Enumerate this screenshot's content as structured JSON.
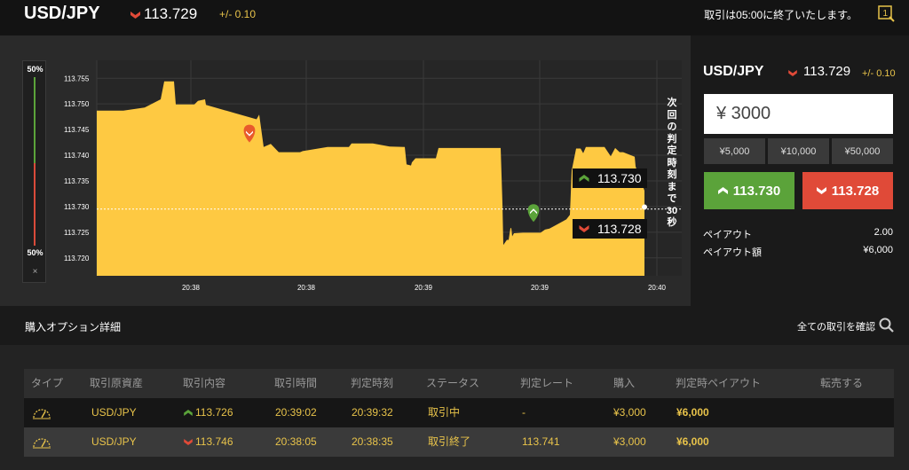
{
  "header": {
    "pair": "USD/JPY",
    "rate": "113.729",
    "change": "+/- 0.10",
    "notice": "取引は05:00に終了いたします。",
    "icon": "new-window-icon"
  },
  "chart_data": {
    "type": "area",
    "y_ticks": [
      "113.755",
      "113.750",
      "113.745",
      "113.740",
      "113.735",
      "113.730",
      "113.725",
      "113.720"
    ],
    "x_ticks": [
      "20:38",
      "20:38",
      "20:39",
      "20:39",
      "20:40"
    ],
    "ylim": [
      113.7165,
      113.7585
    ],
    "series": [
      {
        "values": [
          [
            0,
            113.7487
          ],
          [
            0.1,
            113.7487
          ],
          [
            0.18,
            113.7493
          ],
          [
            0.24,
            113.7509
          ],
          [
            0.2533,
            113.7544
          ],
          [
            0.29,
            113.7544
          ],
          [
            0.2967,
            113.7499
          ],
          [
            0.3667,
            113.7499
          ],
          [
            0.38,
            113.7506
          ],
          [
            0.4067,
            113.7509
          ],
          [
            0.41,
            113.7498
          ],
          [
            0.6,
            113.747
          ],
          [
            0.61,
            113.7479
          ],
          [
            0.6267,
            113.7416
          ],
          [
            0.6533,
            113.7422
          ],
          [
            0.6833,
            113.7406
          ],
          [
            0.7633,
            113.7406
          ],
          [
            0.7733,
            113.7408
          ],
          [
            0.8667,
            113.7416
          ],
          [
            0.9467,
            113.7416
          ],
          [
            0.9567,
            113.7423
          ],
          [
            1.0367,
            113.7423
          ],
          [
            1.1,
            113.7417
          ],
          [
            1.1567,
            113.7416
          ],
          [
            1.1633,
            113.7382
          ],
          [
            1.18,
            113.738
          ],
          [
            1.1833,
            113.7386
          ],
          [
            1.1967,
            113.7394
          ],
          [
            1.2733,
            113.7394
          ],
          [
            1.2833,
            113.7414
          ],
          [
            1.3167,
            113.7414
          ],
          [
            1.3467,
            113.7414
          ],
          [
            1.3567,
            113.7414
          ],
          [
            1.5167,
            113.7414
          ],
          [
            1.5233,
            113.7306
          ],
          [
            1.5267,
            113.7225
          ],
          [
            1.54,
            113.7235
          ],
          [
            1.5467,
            113.7235
          ],
          [
            1.5533,
            113.7258
          ],
          [
            1.5567,
            113.7258
          ],
          [
            1.56,
            113.7242
          ],
          [
            1.5667,
            113.7248
          ],
          [
            1.6,
            113.7249
          ],
          [
            1.6667,
            113.7249
          ],
          [
            1.6833,
            113.7255
          ],
          [
            1.7,
            113.7257
          ],
          [
            1.7633,
            113.7275
          ],
          [
            1.7767,
            113.7284
          ],
          [
            1.7833,
            113.737
          ],
          [
            1.8,
            113.7413
          ],
          [
            1.8167,
            113.7413
          ],
          [
            1.8267,
            113.7404
          ],
          [
            1.8367,
            113.7416
          ],
          [
            1.9067,
            113.7416
          ],
          [
            1.93,
            113.7398
          ],
          [
            1.9467,
            113.7414
          ],
          [
            1.9633,
            113.7406
          ],
          [
            1.9767,
            113.7406
          ],
          [
            2.02,
            113.7397
          ],
          [
            2.0233,
            113.7378
          ],
          [
            2.0567,
            113.7331
          ],
          [
            2.0567,
            113.7299
          ]
        ]
      }
    ],
    "current_rate": 113.7295,
    "markers": [
      {
        "x": 0.5733,
        "y": 113.7444,
        "direction": "down",
        "color": "#e85a2c"
      },
      {
        "x": 1.64,
        "y": 113.7289,
        "direction": "up",
        "color": "#5ba33a"
      }
    ],
    "countdown_label": "次回の判定時刻まで30秒",
    "up_tag": "113.730",
    "down_tag": "113.728",
    "payout_bar": {
      "top_label": "50%",
      "bottom_label": "50%",
      "close": "×"
    }
  },
  "trade_panel": {
    "pair": "USD/JPY",
    "rate": "113.729",
    "change": "+/- 0.10",
    "amount": "¥ 3000",
    "presets": [
      "¥5,000",
      "¥10,000",
      "¥50,000"
    ],
    "buy_up": "113.730",
    "buy_down": "113.728",
    "payout_label": "ペイアウト",
    "payout_value": "2.00",
    "payout_amount_label": "ペイアウト額",
    "payout_amount_value": "¥6,000"
  },
  "details": {
    "title": "購入オプション詳細",
    "link": "全ての取引を確認",
    "columns": [
      "タイプ",
      "取引原資産",
      "取引内容",
      "取引時間",
      "判定時刻",
      "ステータス",
      "判定レート",
      "購入",
      "判定時ペイアウト",
      "転売する"
    ],
    "rows": [
      {
        "asset": "USD/JPY",
        "direction": "up",
        "content": "113.726",
        "time": "20:39:02",
        "judge": "20:39:32",
        "status": "取引中",
        "judge_rate": "-",
        "purchase": "¥3,000",
        "payout": "¥6,000"
      },
      {
        "asset": "USD/JPY",
        "direction": "down",
        "content": "113.746",
        "time": "20:38:05",
        "judge": "20:38:35",
        "status": "取引終了",
        "judge_rate": "113.741",
        "purchase": "¥3,000",
        "payout": "¥6,000"
      }
    ]
  },
  "colors": {
    "area_fill": "#fec942",
    "up": "#5ba33a",
    "down": "#e04a38",
    "accent_text": "#e8c34a"
  }
}
